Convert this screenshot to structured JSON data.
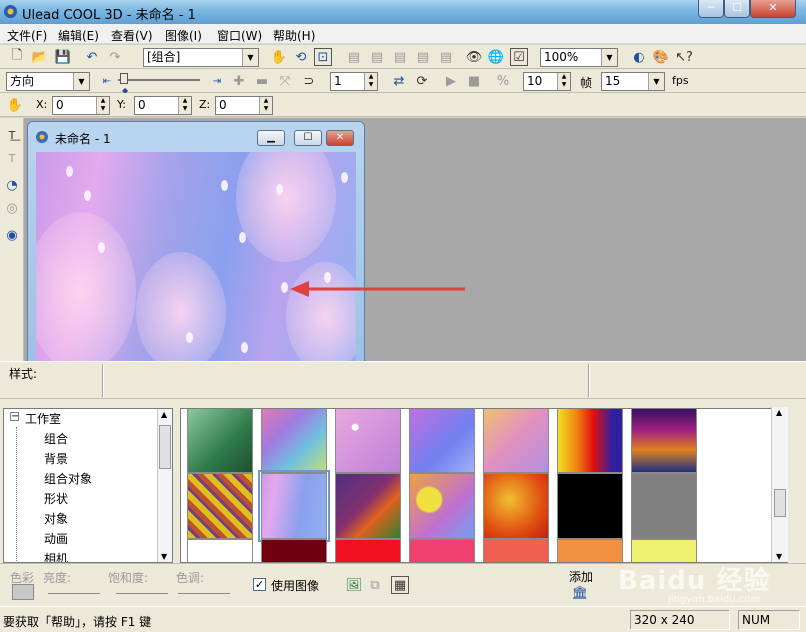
{
  "window": {
    "title": "Ulead COOL 3D - 未命名 - 1",
    "min": "─",
    "max": "☐",
    "close": "✕"
  },
  "menu": [
    "文件(F)",
    "编辑(E)",
    "查看(V)",
    "图像(I)",
    "窗口(W)",
    "帮助(H)"
  ],
  "toolbar1": {
    "object_combo": "[组合]",
    "zoom_combo": "100%"
  },
  "toolbar2": {
    "direction_combo": "方向",
    "frame_value": "1",
    "frames_value": "10",
    "frame_label": "帧",
    "fps_value": "15",
    "fps_label": "fps"
  },
  "toolbar3": {
    "x_label": "X:",
    "x_value": "0",
    "y_label": "Y:",
    "y_value": "0",
    "z_label": "Z:",
    "z_value": "0"
  },
  "document": {
    "title": "未命名 - 1"
  },
  "style_bar": {
    "label": "样式:"
  },
  "tree": {
    "root": "工作室",
    "items": [
      "组合",
      "背景",
      "组合对象",
      "形状",
      "对象",
      "动画",
      "相机"
    ]
  },
  "swatches": {
    "rows": [
      [
        {
          "name": "green-gradient",
          "bg": "linear-gradient(135deg,#8cc8a0,#2f7a4a 60%,#1d4f30)"
        },
        {
          "name": "rainbow-pastel",
          "bg": "linear-gradient(135deg,#e07ab0,#a07ae0 35%,#70c0e0 65%,#c0e070)"
        },
        {
          "name": "pink-sparkle",
          "bg": "radial-gradient(circle at 30% 30%,#fff 0 3px,transparent 4px),linear-gradient(135deg,#e8a8e0,#c080d8)"
        },
        {
          "name": "violet-blue",
          "bg": "linear-gradient(135deg,#c070e0,#7080f0 60%,#a0b0f8)"
        },
        {
          "name": "peach-purple",
          "bg": "linear-gradient(135deg,#f0c070,#e090c0 50%,#b090e0)"
        },
        {
          "name": "fire-blue",
          "bg": "linear-gradient(90deg,#f0e020,#f08010 30%,#e01010 55%,#3020a0 85%)"
        },
        {
          "name": "spectrum-dark",
          "bg": "linear-gradient(180deg,#301060,#a02080 35%,#e08020 65%,#203080)"
        }
      ],
      [
        {
          "name": "cobblestone",
          "bg": "repeating-linear-gradient(45deg,#e0c020 0 6px,#704080 6px 9px,#c05030 9px 14px)"
        },
        {
          "name": "aurora-blue",
          "bg": "linear-gradient(100deg,#c99be8,#e4a9ee 20%,#8aa0ee 60%,#94b0f2)",
          "selected": true
        },
        {
          "name": "purple-green",
          "bg": "linear-gradient(135deg,#503080,#803070 45%,#e06020 65%,#308030)"
        },
        {
          "name": "yellow-pink-blobs",
          "bg": "radial-gradient(circle at 30% 40%,#f0e040 0 12px,transparent 14px),linear-gradient(135deg,#f0a040,#c070d0 60%,#70a0f0)"
        },
        {
          "name": "orange-lava",
          "bg": "radial-gradient(circle at 40% 40%,#f0c030,#e05010 60%,#c02010)"
        },
        {
          "name": "black",
          "bg": "#000000"
        },
        {
          "name": "gray",
          "bg": "#808080"
        }
      ],
      [
        {
          "name": "white",
          "bg": "#ffffff"
        },
        {
          "name": "dark-red",
          "bg": "#700010"
        },
        {
          "name": "red",
          "bg": "#f01020"
        },
        {
          "name": "pink-red",
          "bg": "#f04070"
        },
        {
          "name": "coral",
          "bg": "#f06050"
        },
        {
          "name": "orange",
          "bg": "#f09040"
        },
        {
          "name": "light-yellow",
          "bg": "#f0f070"
        }
      ]
    ]
  },
  "adjust": {
    "color_label": "色彩",
    "brightness_label": "亮度:",
    "saturation_label": "饱和度:",
    "hue_label": "色调:",
    "use_image_label": "使用图像",
    "use_image_checked": "✓",
    "add_label": "添加"
  },
  "status": {
    "help_text": "要获取「帮助」，请按 F1 键",
    "size": "320 x 240",
    "num": "NUM"
  },
  "watermark": {
    "brand": "Baidu 经验",
    "url": "jingyan.baidu.com"
  }
}
